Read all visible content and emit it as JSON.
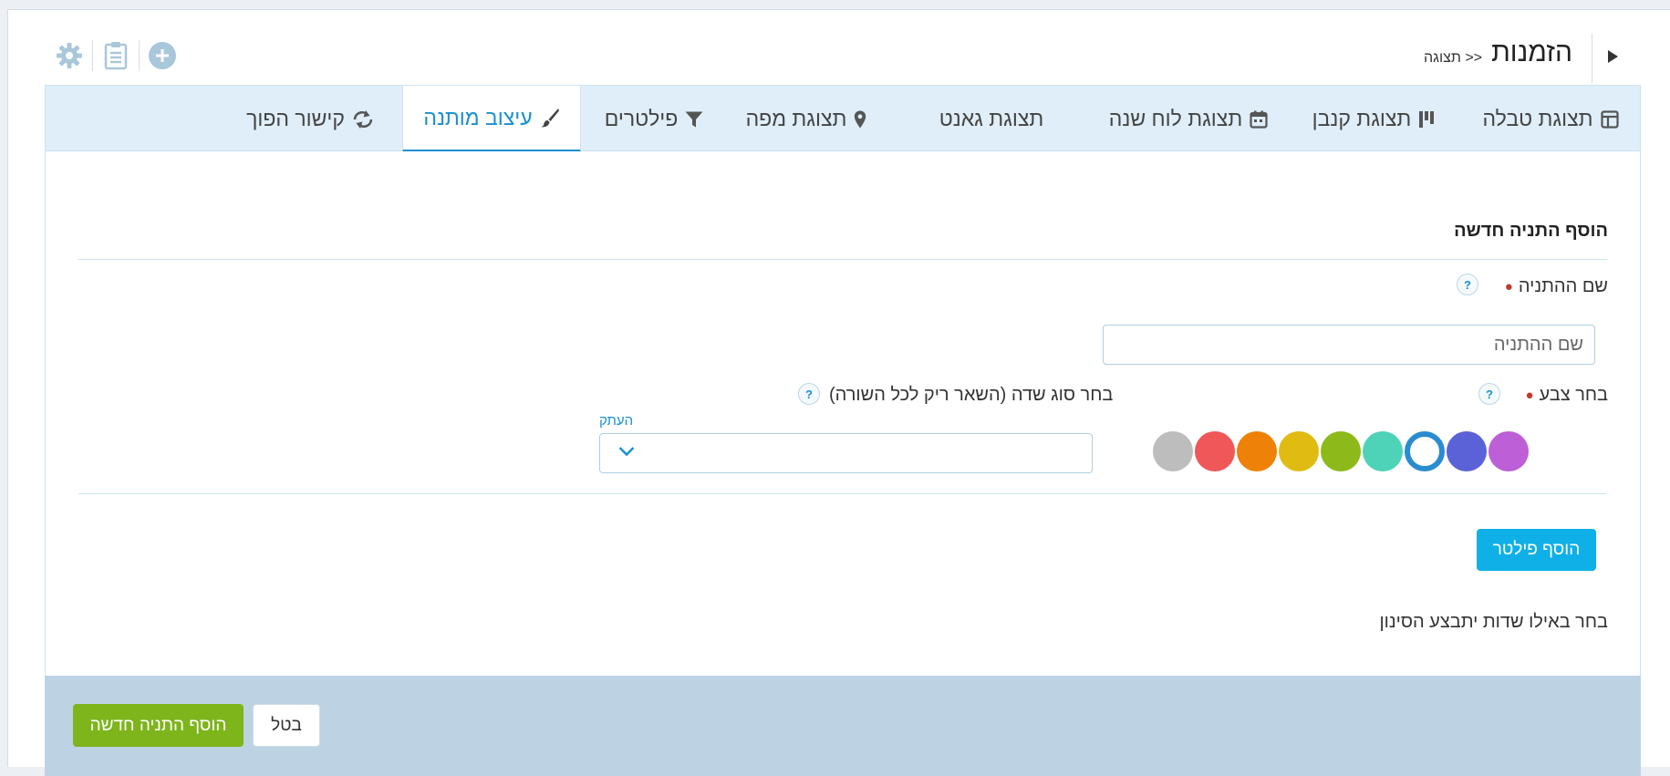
{
  "header": {
    "title": "הזמנות",
    "breadcrumb": "<< תצוגה",
    "icons": [
      "settings-icon",
      "clipboard-icon",
      "add-circle-icon",
      "toggle-arrow-icon"
    ]
  },
  "tabs": [
    {
      "label": "תצוגת טבלה",
      "icon": "table-icon"
    },
    {
      "label": "תצוגת קנבן",
      "icon": "kanban-icon"
    },
    {
      "label": "תצוגת לוח שנה",
      "icon": "calendar-icon"
    },
    {
      "label": "תצוגת גאנט",
      "icon": ""
    },
    {
      "label": "תצוגת מפה",
      "icon": "map-pin-icon"
    },
    {
      "label": "פילטרים",
      "icon": "filter-icon"
    },
    {
      "label": "עיצוב מותנה",
      "icon": "brush-icon",
      "active": true
    },
    {
      "label": "קישור הפוך",
      "icon": "reverse-link-icon"
    }
  ],
  "form": {
    "section_title": "הוסף התניה חדשה",
    "condition_name_label": "שם ההתניה",
    "condition_name_placeholder": "שם ההתניה",
    "condition_name_value": "",
    "color_label": "בחר צבע",
    "colors": [
      "#bd5fd6",
      "#5b62d8",
      "#ffffff",
      "#4ed3b9",
      "#8dba1a",
      "#e0bc13",
      "#ee8108",
      "#ef5758",
      "#bdbdbd"
    ],
    "selected_color_index": 2,
    "field_type_label": "בחר סוג שדה (השאר ריק לכל השורה)",
    "field_type_value": "",
    "copy_link": "העתק",
    "add_filter_button": "הוסף פילטר",
    "filter_hint": "בחר באילו שדות יתבצע הסינון",
    "help_mark": "?"
  },
  "footer": {
    "submit_button": "הוסף התניה חדשה",
    "cancel_button": "בטל"
  },
  "theme": {
    "accent": "#1a8fd1",
    "tab_bar_bg": "#dfeef8",
    "footer_bg": "#bdd3e4",
    "submit_green": "#7db51b",
    "filter_blue": "#0fb0e8"
  }
}
